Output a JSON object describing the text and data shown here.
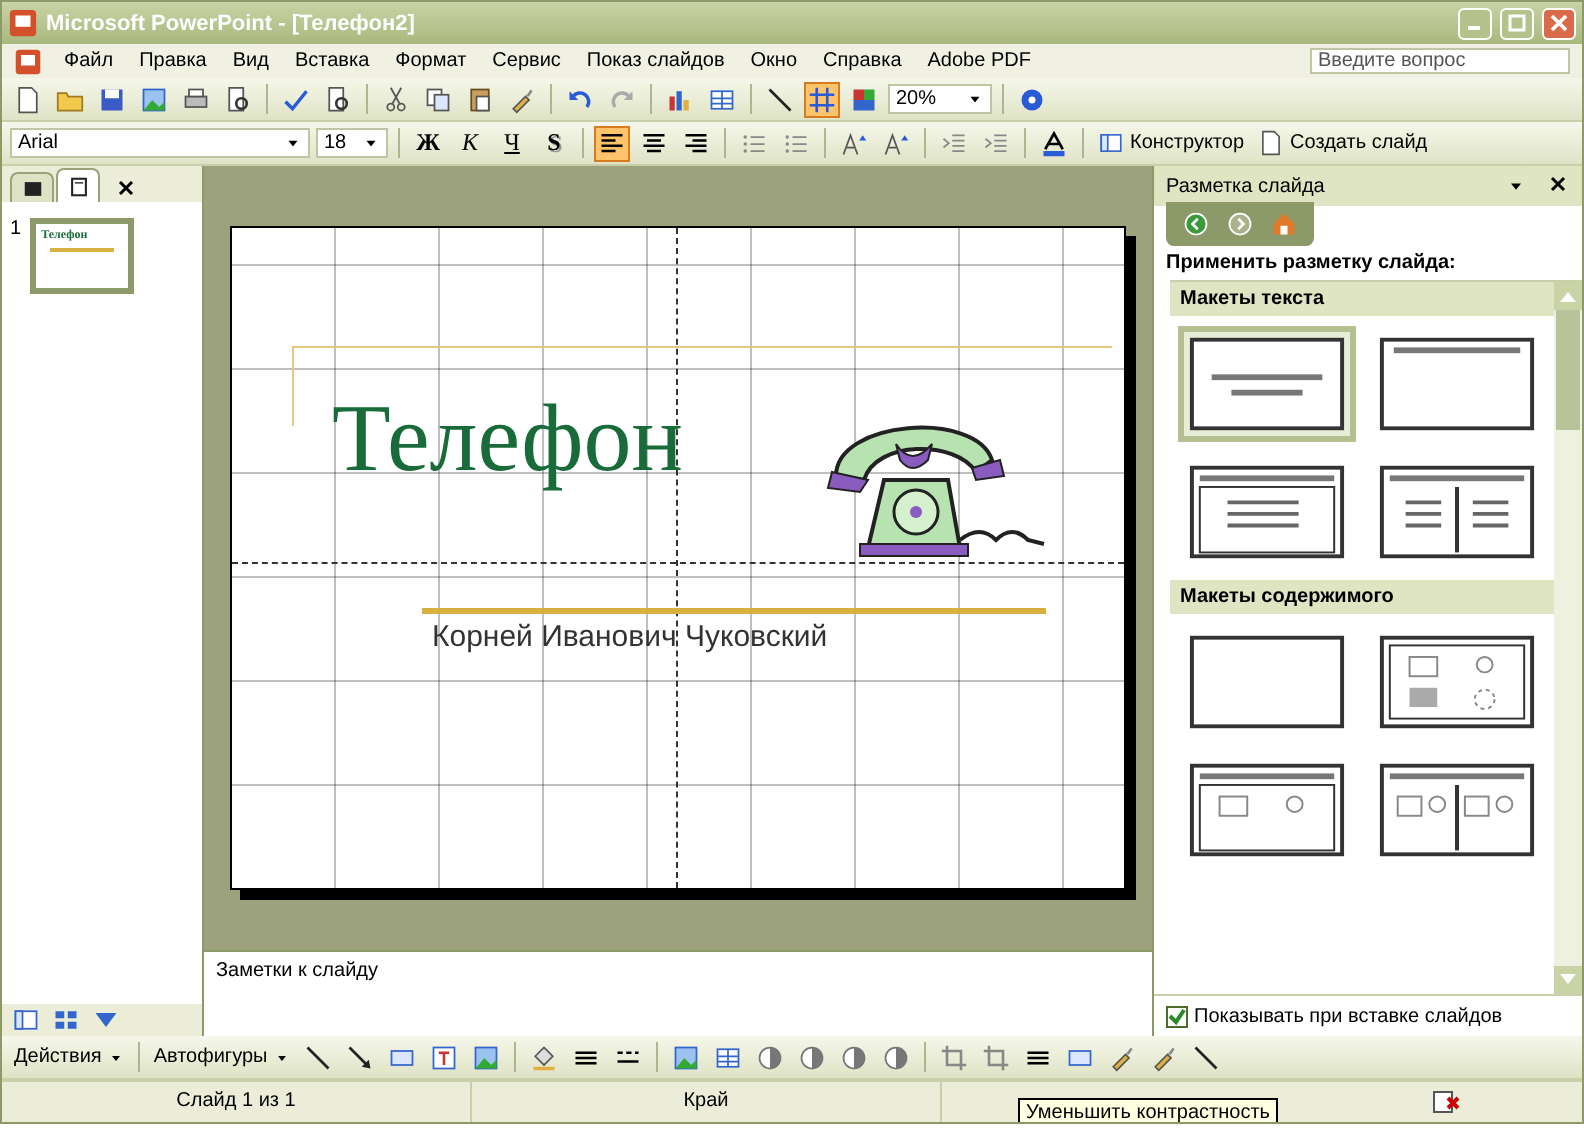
{
  "window": {
    "title": "Microsoft PowerPoint - [Телефон2]"
  },
  "menu": [
    "Файл",
    "Правка",
    "Вид",
    "Вставка",
    "Формат",
    "Сервис",
    "Показ слайдов",
    "Окно",
    "Справка",
    "Adobe PDF"
  ],
  "help_search": {
    "placeholder": "Введите вопрос"
  },
  "zoom": "20%",
  "grid_toggle": {
    "on": true
  },
  "formatting": {
    "font": "Arial",
    "size": "18",
    "style_buttons": [
      {
        "label": "Ж",
        "kind": "bold"
      },
      {
        "label": "К",
        "kind": "italic"
      },
      {
        "label": "Ч",
        "kind": "underline"
      },
      {
        "label": "S",
        "kind": "shadow"
      }
    ],
    "align": [
      {
        "selected": true
      },
      {
        "selected": false
      },
      {
        "selected": false
      }
    ],
    "designer": "Конструктор",
    "new_slide": "Создать слайд"
  },
  "outline_tabs": [
    {
      "selected": false
    },
    {
      "selected": true
    }
  ],
  "slides": [
    {
      "number": "1",
      "title": "Телефон"
    }
  ],
  "slide": {
    "title": "Телефон",
    "subtitle": "Корней Иванович Чуковский"
  },
  "notes": {
    "placeholder": "Заметки к слайду"
  },
  "task_pane": {
    "title": "Разметка слайда",
    "heading": "Применить разметку слайда:",
    "sections": [
      {
        "title": "Макеты текста",
        "layouts": [
          {
            "kind": "title",
            "selected": true
          },
          {
            "kind": "title-only",
            "selected": false
          },
          {
            "kind": "bullets",
            "selected": false
          },
          {
            "kind": "two-columns",
            "selected": false
          }
        ]
      },
      {
        "title": "Макеты содержимого",
        "layouts": [
          {
            "kind": "blank",
            "selected": false
          },
          {
            "kind": "content",
            "selected": false
          },
          {
            "kind": "title-content",
            "selected": false
          },
          {
            "kind": "two-content",
            "selected": false
          }
        ]
      }
    ],
    "show_on_insert": {
      "label": "Показывать при вставке слайдов",
      "checked": true
    }
  },
  "drawing_toolbar": {
    "actions": "Действия",
    "autoshapes": "Автофигуры"
  },
  "status_bar": [
    "Слайд 1 из 1",
    "Край"
  ],
  "tooltip": "Уменьшить контрастность"
}
